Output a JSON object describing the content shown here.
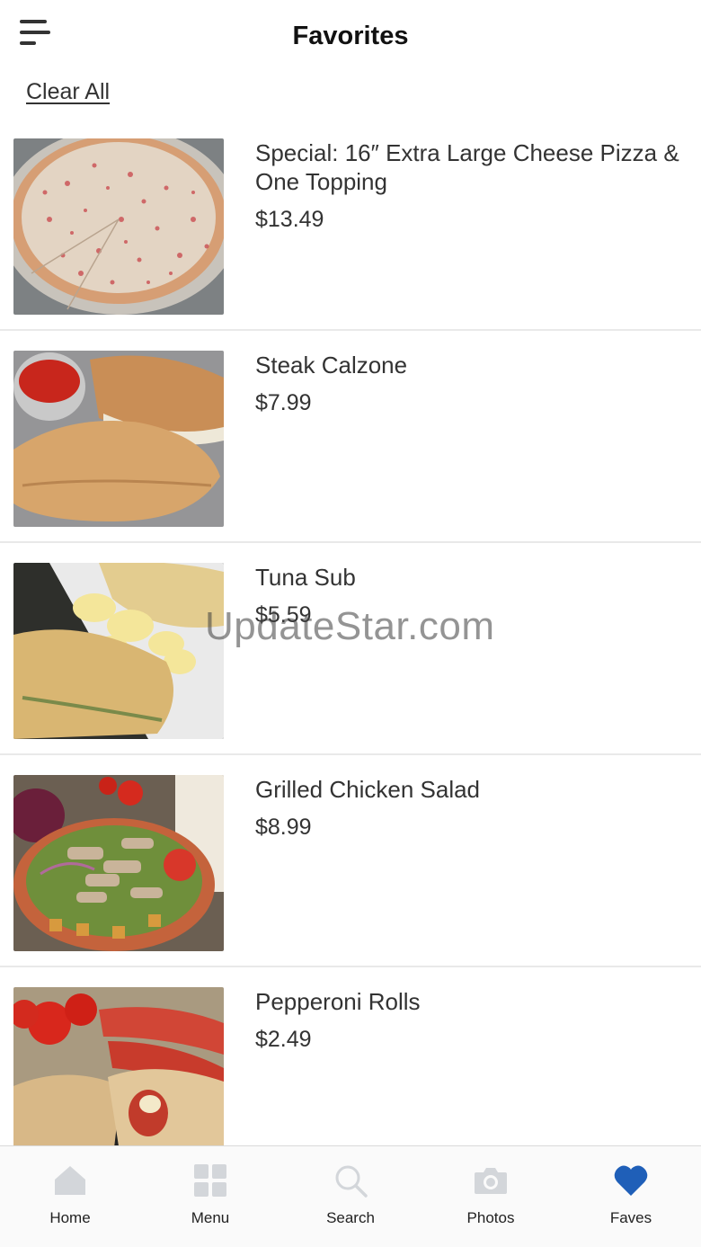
{
  "header": {
    "title": "Favorites",
    "menu_icon": "hamburger-menu-icon"
  },
  "clear_all_label": "Clear All",
  "items": [
    {
      "name": "Special: 16″ Extra Large Cheese Pizza & One Topping",
      "price": "$13.49",
      "image": "cheese-pizza"
    },
    {
      "name": "Steak Calzone",
      "price": "$7.99",
      "image": "calzone"
    },
    {
      "name": "Tuna Sub",
      "price": "$5.59",
      "image": "tuna-sub-with-chips"
    },
    {
      "name": "Grilled Chicken Salad",
      "price": "$8.99",
      "image": "chicken-salad"
    },
    {
      "name": "Pepperoni Rolls",
      "price": "$2.49",
      "image": "pepperoni-rolls"
    }
  ],
  "watermark": "UpdateStar.com",
  "tabbar": {
    "active_color": "#1f5fb8",
    "inactive_icon_color": "#d3d6da",
    "tabs": [
      {
        "label": "Home",
        "icon": "home-icon",
        "active": false
      },
      {
        "label": "Menu",
        "icon": "grid-icon",
        "active": false
      },
      {
        "label": "Search",
        "icon": "search-icon",
        "active": false
      },
      {
        "label": "Photos",
        "icon": "camera-icon",
        "active": false
      },
      {
        "label": "Faves",
        "icon": "heart-icon",
        "active": true
      }
    ]
  }
}
